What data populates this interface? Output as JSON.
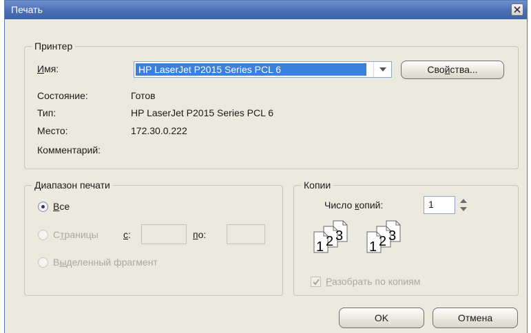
{
  "window": {
    "title": "Печать"
  },
  "printer": {
    "group_label": "Принтер",
    "name_label": "Имя:",
    "name_value": "HP LaserJet P2015 Series PCL 6",
    "properties_button": "Свойства...",
    "status_label": "Состояние:",
    "status_value": "Готов",
    "type_label": "Тип:",
    "type_value": "HP LaserJet P2015 Series PCL 6",
    "location_label": "Место:",
    "location_value": "172.30.0.222",
    "comment_label": "Комментарий:"
  },
  "range": {
    "group_label": "Диапазон печати",
    "all_label": "Все",
    "pages_label": "Страницы",
    "from_label": "с:",
    "to_label": "по:",
    "selection_label": "Выделенный фрагмент",
    "selected": "all"
  },
  "copies": {
    "group_label": "Копии",
    "count_label": "Число копий:",
    "count_value": "1",
    "collate_label": "Разобрать по копиям",
    "collate_checked": true,
    "collate_page_numbers": [
      "1",
      "2",
      "3"
    ]
  },
  "buttons": {
    "ok": "OK",
    "cancel": "Отмена"
  },
  "colors": {
    "titlebar": "#4a6fb6",
    "selection": "#3a80de",
    "dialog_bg": "#ece9df"
  }
}
